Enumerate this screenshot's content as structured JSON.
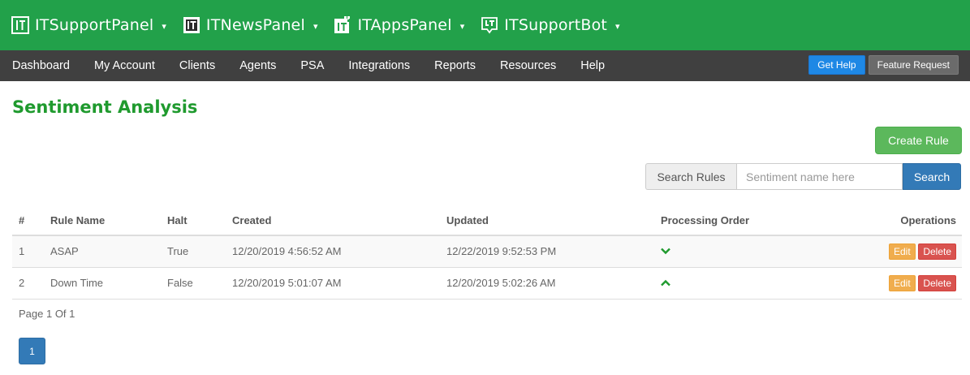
{
  "header": {
    "brands": [
      {
        "name": "ITSupportPanel",
        "icon": "it-logo-icon"
      },
      {
        "name": "ITNewsPanel",
        "icon": "it-news-logo-icon"
      },
      {
        "name": "ITAppsPanel",
        "icon": "it-apps-logo-icon"
      },
      {
        "name": "ITSupportBot",
        "icon": "it-bot-logo-icon"
      }
    ],
    "caret": "▾",
    "color": "#22a14a"
  },
  "nav": {
    "items": [
      "Dashboard",
      "My Account",
      "Clients",
      "Agents",
      "PSA",
      "Integrations",
      "Reports",
      "Resources",
      "Help"
    ],
    "get_help": "Get Help",
    "feature_request": "Feature Request"
  },
  "page": {
    "title": "Sentiment Analysis",
    "create_rule": "Create Rule"
  },
  "search": {
    "label": "Search Rules",
    "placeholder": "Sentiment name here",
    "button": "Search"
  },
  "table": {
    "headers": {
      "num": "#",
      "name": "Rule Name",
      "halt": "Halt",
      "created": "Created",
      "updated": "Updated",
      "order": "Processing Order",
      "ops": "Operations"
    },
    "rows": [
      {
        "num": "1",
        "name": "ASAP",
        "halt": "True",
        "created": "12/20/2019 4:56:52 AM",
        "updated": "12/22/2019 9:52:53 PM",
        "order_icon": "chevron-down-icon",
        "edit": "Edit",
        "delete": "Delete"
      },
      {
        "num": "2",
        "name": "Down Time",
        "halt": "False",
        "created": "12/20/2019 5:01:07 AM",
        "updated": "12/20/2019 5:02:26 AM",
        "order_icon": "chevron-up-icon",
        "edit": "Edit",
        "delete": "Delete"
      }
    ]
  },
  "pagination": {
    "info": "Page 1 Of 1",
    "current": "1"
  }
}
